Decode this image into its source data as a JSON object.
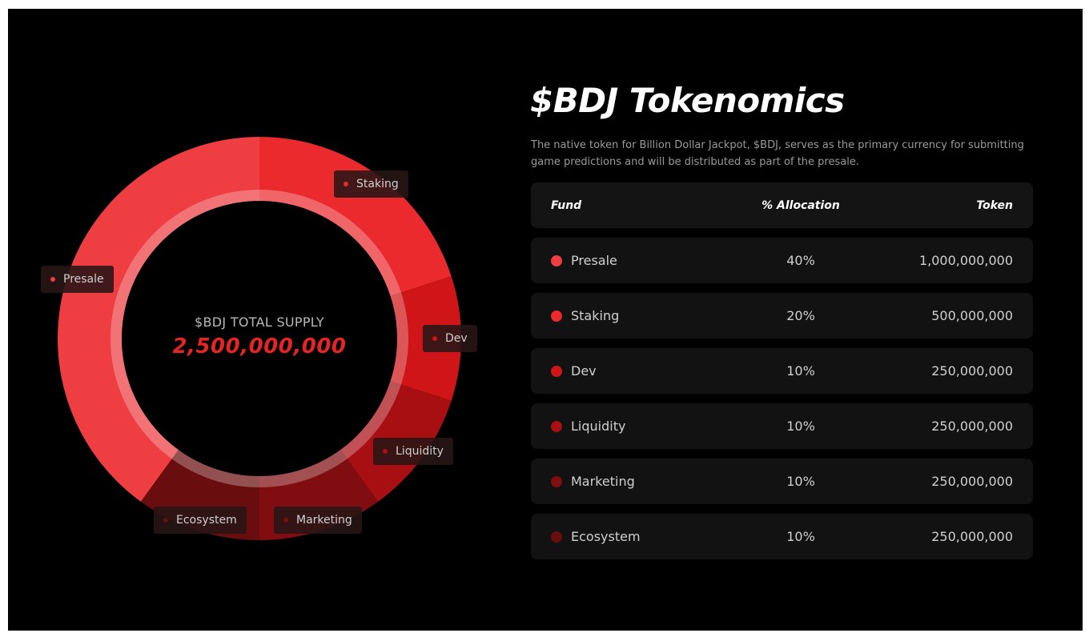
{
  "chart_data": {
    "type": "pie",
    "center_title": "$BDJ TOTAL SUPPLY",
    "center_value": "2,500,000,000",
    "categories": [
      "Presale",
      "Staking",
      "Dev",
      "Liquidity",
      "Marketing",
      "Ecosystem"
    ],
    "values": [
      40,
      20,
      10,
      10,
      10,
      10
    ],
    "colors": [
      "#ee3e42",
      "#ea2a2d",
      "#cf1518",
      "#a80f13",
      "#800d10",
      "#6a0d0f"
    ],
    "labels": [
      {
        "text": "Presale",
        "dot_color": "#ee3e42"
      },
      {
        "text": "Staking",
        "dot_color": "#ea2a2d"
      },
      {
        "text": "Dev",
        "dot_color": "#cf1518"
      },
      {
        "text": "Liquidity",
        "dot_color": "#a80f13"
      },
      {
        "text": "Marketing",
        "dot_color": "#800d10"
      },
      {
        "text": "Ecosystem",
        "dot_color": "#6a0d0f"
      }
    ]
  },
  "panel": {
    "title": "$BDJ Tokenomics",
    "description": "The native token for Billion Dollar Jackpot, $BDJ, serves as the primary currency for submitting game predictions and will be distributed as part of the presale."
  },
  "table": {
    "headers": {
      "fund": "Fund",
      "allocation": "% Allocation",
      "token": "Token"
    },
    "rows": [
      {
        "fund": "Presale",
        "allocation": "40%",
        "token": "1,000,000,000",
        "dot_color": "#ee3e42"
      },
      {
        "fund": "Staking",
        "allocation": "20%",
        "token": "500,000,000",
        "dot_color": "#ea2a2d"
      },
      {
        "fund": "Dev",
        "allocation": "10%",
        "token": "250,000,000",
        "dot_color": "#cf1518"
      },
      {
        "fund": "Liquidity",
        "allocation": "10%",
        "token": "250,000,000",
        "dot_color": "#a80f13"
      },
      {
        "fund": "Marketing",
        "allocation": "10%",
        "token": "250,000,000",
        "dot_color": "#800d10"
      },
      {
        "fund": "Ecosystem",
        "allocation": "10%",
        "token": "250,000,000",
        "dot_color": "#6a0d0f"
      }
    ]
  },
  "colors": {
    "background": "#000000",
    "accent": "#e52424",
    "row_background": "#121212"
  }
}
